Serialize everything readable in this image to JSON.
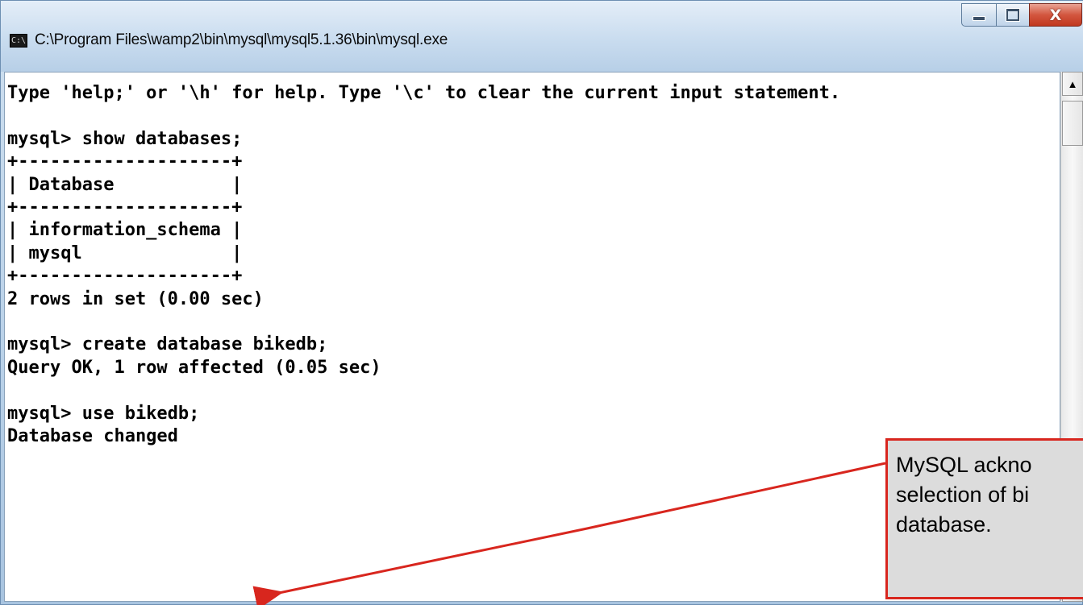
{
  "window": {
    "title": "C:\\Program Files\\wamp2\\bin\\mysql\\mysql5.1.36\\bin\\mysql.exe",
    "icon": "console-app-icon",
    "icon_text": "C:\\",
    "controls": {
      "minimize_icon": "minimize-icon",
      "maximize_icon": "maximize-icon",
      "close_icon": "close-icon",
      "close_label": "X"
    }
  },
  "console": {
    "text": "Type 'help;' or '\\h' for help. Type '\\c' to clear the current input statement.\n\nmysql> show databases;\n+--------------------+\n| Database           |\n+--------------------+\n| information_schema |\n| mysql              |\n+--------------------+\n2 rows in set (0.00 sec)\n\nmysql> create database bikedb;\nQuery OK, 1 row affected (0.05 sec)\n\nmysql> use bikedb;\nDatabase changed"
  },
  "scrollbar": {
    "up_icon": "scroll-up-arrow-icon",
    "down_icon": "scroll-down-arrow-icon"
  },
  "annotation": {
    "text": "MySQL ackno\nselection of bi\ndatabase.",
    "border_color": "#d8261e",
    "background": "#dcdcdc"
  }
}
